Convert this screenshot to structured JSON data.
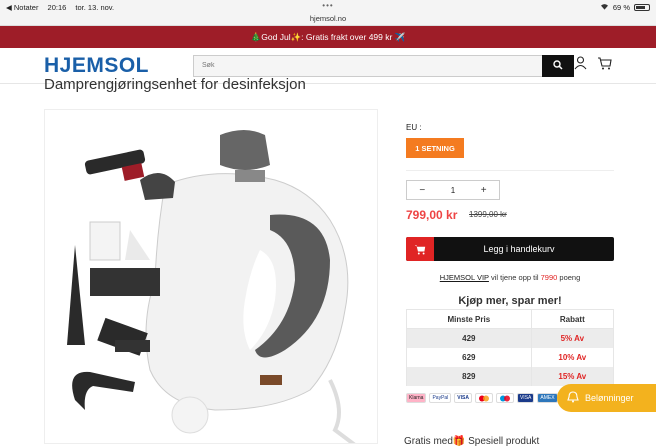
{
  "status": {
    "back": "◀ Notater",
    "time": "20:16",
    "date": "tor. 13. nov.",
    "battery": "69 %"
  },
  "url": "hjemsol.no",
  "promo": "🎄God Jul✨: Gratis frakt over 499 kr ✈️",
  "header": {
    "logo": "HJEMSOL",
    "search_placeholder": "Søk"
  },
  "product": {
    "title": "Damprengjøringsenhet for desinfeksjon",
    "variant_label": "EU :",
    "variant": "1 SETNING",
    "quantity": "1",
    "price": "799,00 kr",
    "old_price": "1399,00 kr",
    "add_to_cart": "Legg i handlekurv",
    "vip_link": "HJEMSOL VIP",
    "vip_text": " vil tjene opp til ",
    "vip_points": "7990",
    "vip_suffix": " poeng",
    "buy_more": "Kjøp mer, spar mer!"
  },
  "discount_table": {
    "headers": [
      "Minste Pris",
      "Rabatt"
    ],
    "rows": [
      [
        "429",
        "5% Av"
      ],
      [
        "629",
        "10% Av"
      ],
      [
        "829",
        "15% Av"
      ]
    ]
  },
  "payments": [
    "Klarna",
    "PayPal",
    "VISA",
    "MC",
    "MC",
    "VISA",
    "AMEX"
  ],
  "rewards": "Belønninger",
  "below_text": "Gratis med​🎁 Spesiell produkt",
  "colors": {
    "promo": "#9e1d28",
    "logo": "#1a5fa8",
    "variant": "#f47b20",
    "price": "#e44444",
    "cart_icon": "#e02424",
    "rewards": "#f3b21e"
  }
}
